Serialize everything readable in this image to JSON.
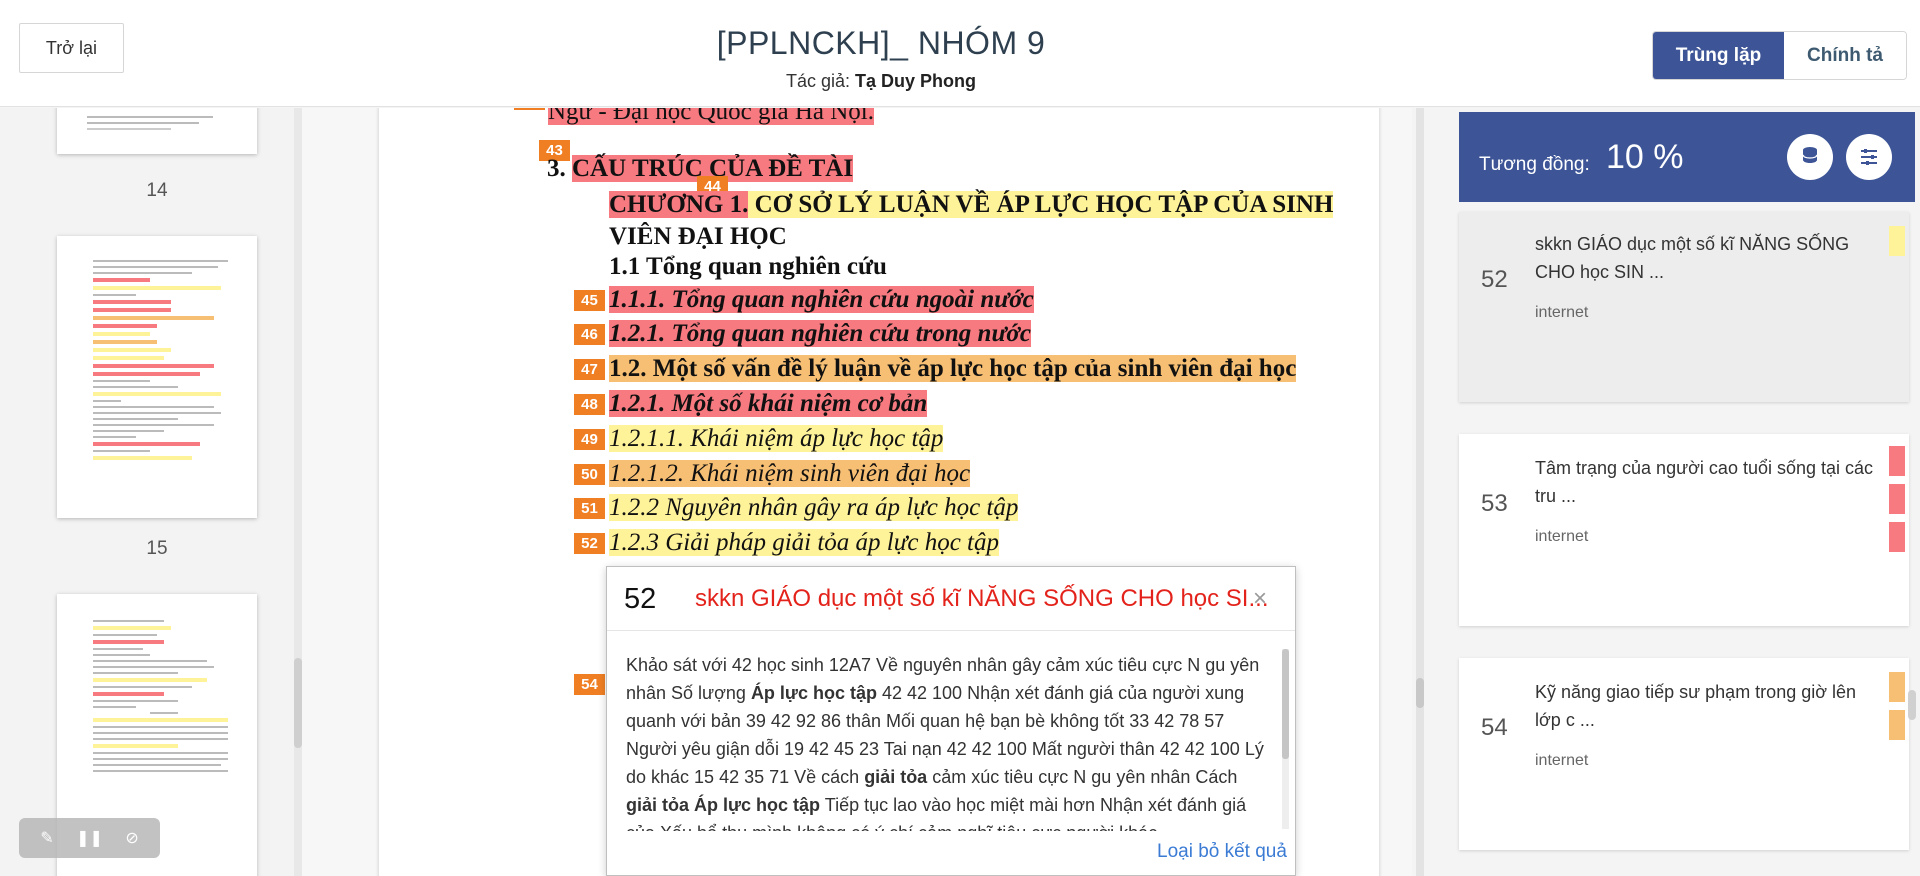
{
  "header": {
    "back_label": "Trở lại",
    "title": "[PPLNCKH]_ NHÓM 9",
    "author_prefix": "Tác giả:",
    "author_name": "Tạ Duy Phong",
    "tabs": [
      {
        "label": "Trùng lặp",
        "active": true
      },
      {
        "label": "Chính tả",
        "active": false
      }
    ]
  },
  "thumbnails": {
    "page_numbers": [
      "14",
      "15"
    ]
  },
  "document": {
    "lines": [
      {
        "text": "Ngữ - Đại học Quốc gia Hà Nội.",
        "tag": ""
      },
      {
        "text": "3. CẤU TRÚC CỦA ĐỀ TÀI",
        "tag": "43"
      },
      {
        "text": "CHƯƠNG 1. CƠ SỞ LÝ LUẬN VỀ ÁP LỰC HỌC TẬP CỦA SINH",
        "tag": "44"
      },
      {
        "text": "VIÊN ĐẠI HỌC",
        "tag": ""
      },
      {
        "text": "1.1 Tổng quan nghiên cứu",
        "tag": ""
      },
      {
        "text": "1.1.1. Tổng quan nghiên cứu ngoài nước",
        "tag": "45"
      },
      {
        "text": "1.2.1. Tổng quan nghiên cứu trong nước",
        "tag": "46"
      },
      {
        "text": "1.2. Một số vấn đề lý luận về áp lực học tập của sinh viên đại học",
        "tag": "47"
      },
      {
        "text": "1.2.1. Một số khái niệm cơ bản",
        "tag": "48"
      },
      {
        "text": "1.2.1.1. Khái niệm áp lực học tập",
        "tag": "49"
      },
      {
        "text": "1.2.1.2. Khái niệm sinh viên đại học",
        "tag": "50"
      },
      {
        "text": "1.2.2 Nguyên nhân gây ra áp lực học tập",
        "tag": "51"
      },
      {
        "text": "1.2.3 Giải pháp giải tỏa áp lực học tập",
        "tag": "52"
      }
    ],
    "hidden_tag": "54"
  },
  "popup": {
    "number": "52",
    "title": "skkn GIÁO dục một số kĩ NĂNG SỐNG CHO học SI...",
    "close_glyph": "×",
    "body_parts": [
      {
        "t": "Khảo sát với 42 học sinh 12A7 Về nguyên nhân gây cảm xúc tiêu cực N gu yên nhân Số lượng ",
        "b": false
      },
      {
        "t": "Áp lực học tập",
        "b": true
      },
      {
        "t": " 42 42 100 Nhận xét đánh giá của người xung quanh với bản 39 42 92 86 thân Mối quan hệ bạn bè không tốt 33 42 78 57 Người yêu giận dỗi 19 42 45 23 Tai nạn 42 42 100 Mất người thân 42 42 100 Lý do khác 15 42 35 71 Về cách ",
        "b": false
      },
      {
        "t": "giải tỏa",
        "b": true
      },
      {
        "t": " cảm xúc tiêu cực N gu yên nhân Cách ",
        "b": false
      },
      {
        "t": "giải tỏa Áp lực học tập",
        "b": true
      },
      {
        "t": " Tiếp tục lao vào học miệt mài hơn Nhận xét đánh giá của Xấu hổ thu mình không có ý chí cảm nghĩ tiêu cực người khác",
        "b": false
      }
    ],
    "dismiss_label": "Loại bỏ kết quả"
  },
  "results_panel": {
    "similarity_label": "Tương đồng:",
    "similarity_value": "10 %",
    "buttons": [
      "database-icon",
      "sliders-icon"
    ],
    "cards": [
      {
        "num": "52",
        "title": "skkn GIÁO dục một số kĩ NĂNG SỐNG CHO học SIN ...",
        "source": "internet",
        "marks": [
          "#fff39a"
        ]
      },
      {
        "num": "53",
        "title": "Tâm trạng của người cao tuổi sống tại các tru ...",
        "source": "internet",
        "marks": [
          "#f67a80",
          "#f67a80",
          "#f67a80"
        ]
      },
      {
        "num": "54",
        "title": "Kỹ năng giao tiếp sư phạm trong giờ lên lớp c ...",
        "source": "internet",
        "marks": [
          "#f7bf73",
          "#f7bf73"
        ]
      }
    ]
  },
  "colors": {
    "primary": "#3d5597",
    "highlight_red": "#f67a80",
    "highlight_yellow": "#fff39a",
    "highlight_orange": "#f7bf73",
    "tag_orange": "#f07f24",
    "popup_title": "#e3231b",
    "link": "#3b7bd4"
  }
}
